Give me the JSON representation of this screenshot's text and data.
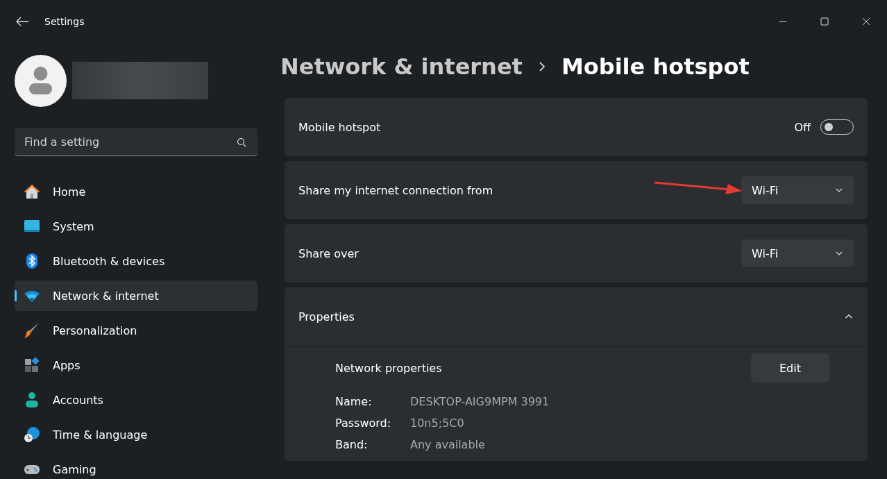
{
  "window": {
    "title": "Settings"
  },
  "search": {
    "placeholder": "Find a setting"
  },
  "sidebar": {
    "items": [
      {
        "label": "Home",
        "kind": "home",
        "selected": false
      },
      {
        "label": "System",
        "kind": "system",
        "selected": false
      },
      {
        "label": "Bluetooth & devices",
        "kind": "bluetooth",
        "selected": false
      },
      {
        "label": "Network & internet",
        "kind": "network",
        "selected": true
      },
      {
        "label": "Personalization",
        "kind": "brush",
        "selected": false
      },
      {
        "label": "Apps",
        "kind": "apps",
        "selected": false
      },
      {
        "label": "Accounts",
        "kind": "accounts",
        "selected": false
      },
      {
        "label": "Time & language",
        "kind": "time",
        "selected": false
      },
      {
        "label": "Gaming",
        "kind": "gaming",
        "selected": false
      }
    ]
  },
  "breadcrumb": {
    "parent": "Network & internet",
    "current": "Mobile hotspot"
  },
  "settings": [
    {
      "kind": "toggle",
      "label": "Mobile hotspot",
      "state_label": "Off",
      "on": false
    },
    {
      "kind": "dropdown",
      "label": "Share my internet connection from",
      "value": "Wi-Fi"
    },
    {
      "kind": "dropdown",
      "label": "Share over",
      "value": "Wi-Fi"
    }
  ],
  "properties": {
    "label": "Properties",
    "expanded": true,
    "section_title": "Network properties",
    "button": "Edit",
    "fields": [
      {
        "label": "Name:",
        "value": "DESKTOP-AIG9MPM 3991"
      },
      {
        "label": "Password:",
        "value": "10n5;5C0"
      },
      {
        "label": "Band:",
        "value": "Any available"
      }
    ]
  }
}
